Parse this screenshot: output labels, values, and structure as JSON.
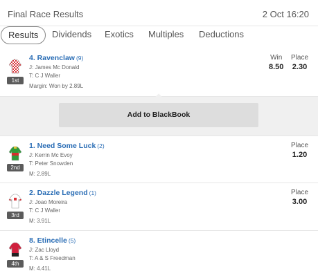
{
  "header": {
    "title": "Final Race Results",
    "date": "2 Oct 16:20"
  },
  "tabs": [
    "Results",
    "Dividends",
    "Exotics",
    "Multiples",
    "Deductions"
  ],
  "runners": [
    {
      "position": "1st",
      "name": "4. Ravenclaw",
      "barrier": "(9)",
      "jockey": "J: James Mc Donald",
      "trainer": "T: C J Waller",
      "margin": "Margin: Won by 2.89L",
      "win_label": "Win",
      "win": "8.50",
      "place_label": "Place",
      "place": "2.30",
      "silk_colors": [
        "#d9343a",
        "#ffffff"
      ]
    },
    {
      "position": "2nd",
      "name": "1. Need Some Luck",
      "barrier": "(2)",
      "jockey": "J: Kerrin Mc Evoy",
      "trainer": "T: Peter Snowden",
      "margin": "M: 2.89L",
      "place_label": "Place",
      "place": "1.20",
      "silk_colors": [
        "#2f9b3a",
        "#d62d2d"
      ]
    },
    {
      "position": "3rd",
      "name": "2. Dazzle Legend",
      "barrier": "(1)",
      "jockey": "J: Joao Moreira",
      "trainer": "T: C J Waller",
      "margin": "M: 3.91L",
      "place_label": "Place",
      "place": "3.00",
      "silk_colors": [
        "#ffffff",
        "#d9343a"
      ]
    },
    {
      "position": "4th",
      "name": "8. Etincelle",
      "barrier": "(5)",
      "jockey": "J: Zac Lloyd",
      "trainer": "T: A & S Freedman",
      "margin": "M: 4.41L",
      "silk_colors": [
        "#d01f3c",
        "#222222"
      ]
    }
  ],
  "expanded": {
    "button_label": "Add to BlackBook"
  }
}
